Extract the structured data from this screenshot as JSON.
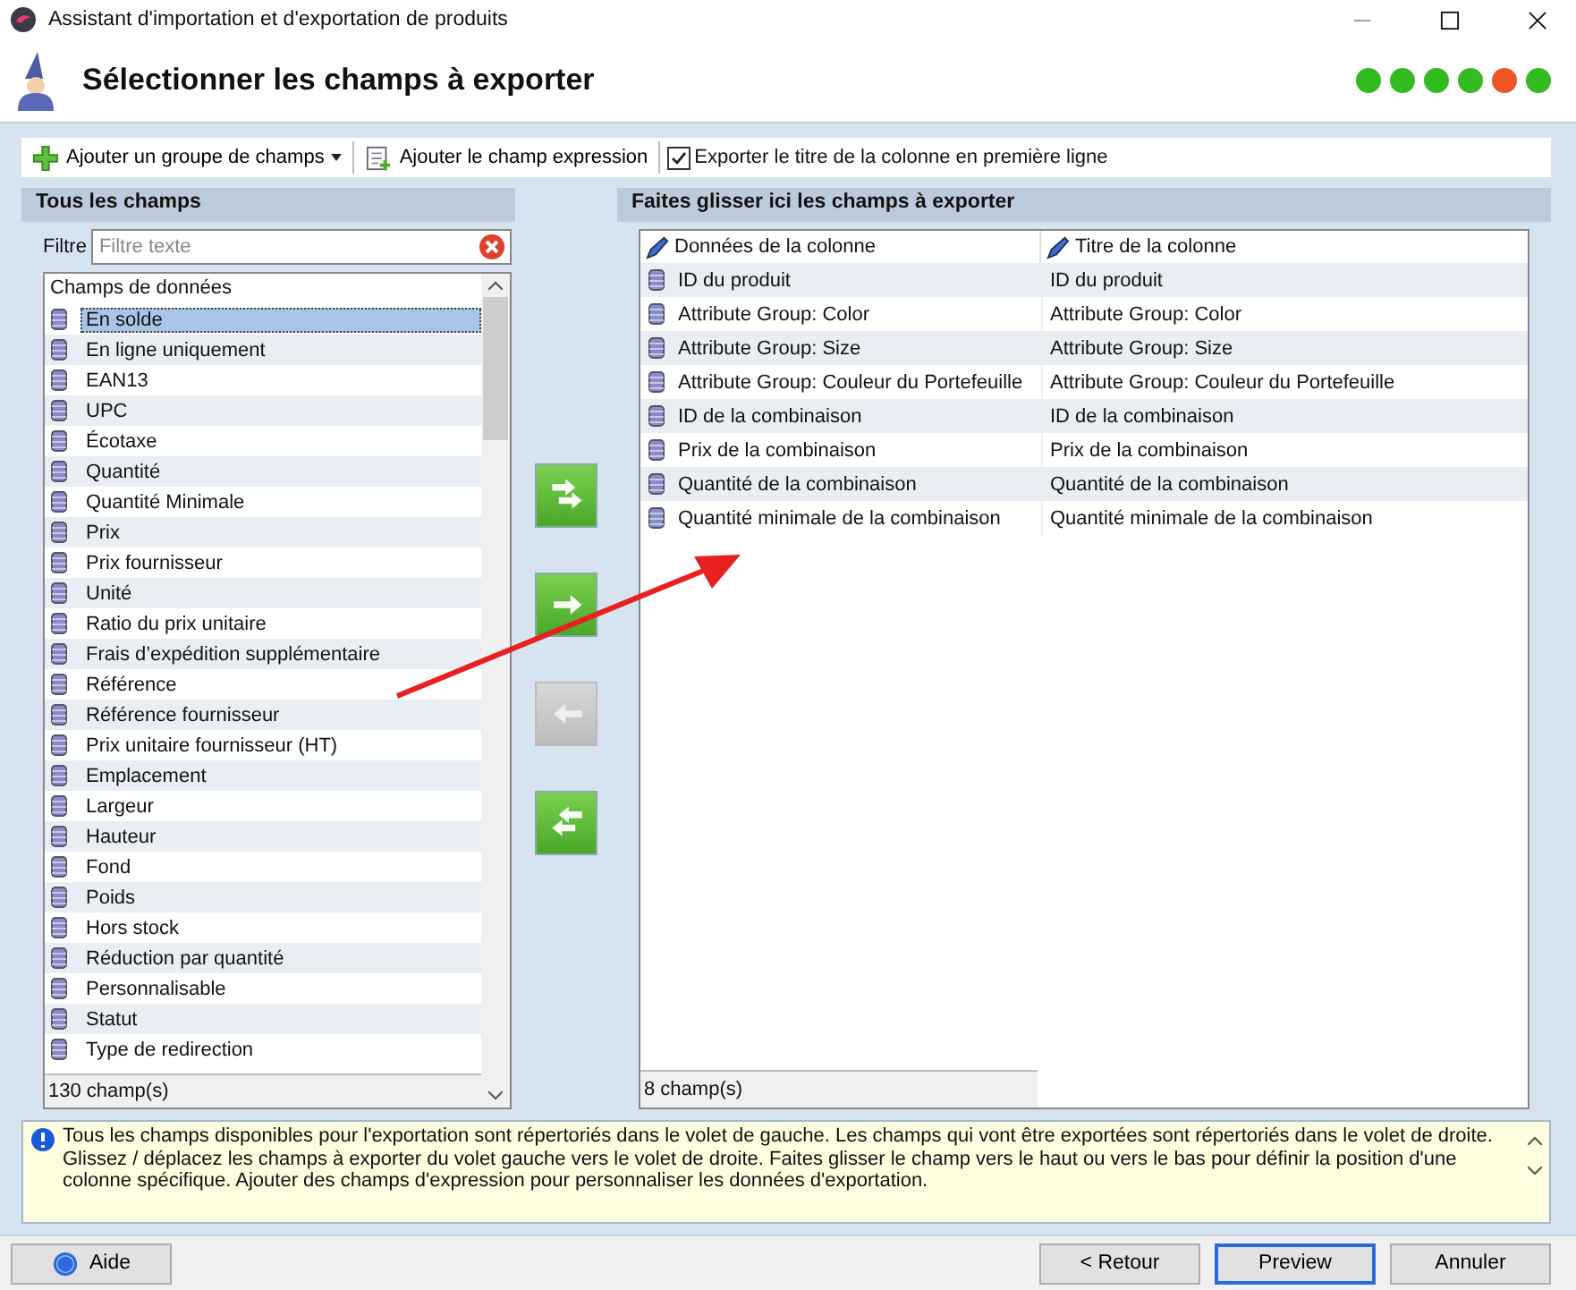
{
  "window": {
    "title": "Assistant d'importation et d'exportation de produits"
  },
  "header": {
    "title": "Sélectionner les champs à exporter",
    "steps": [
      {
        "color": "#33bb22"
      },
      {
        "color": "#33bb22"
      },
      {
        "color": "#33bb22"
      },
      {
        "color": "#33bb22"
      },
      {
        "color": "#ee5522"
      },
      {
        "color": "#33bb22"
      }
    ]
  },
  "toolbar": {
    "add_group": "Ajouter un groupe de champs",
    "add_expression": "Ajouter le champ expression",
    "export_titles": {
      "label": "Exporter le titre de la colonne en première ligne",
      "checked": true
    }
  },
  "left_panel": {
    "title": "Tous les champs",
    "filter_label": "Filtre",
    "filter_placeholder": "Filtre texte",
    "list_header": "Champs de données",
    "items": [
      {
        "label": "En solde",
        "selected": true
      },
      {
        "label": "En ligne uniquement",
        "selected": false
      },
      {
        "label": "EAN13",
        "selected": false
      },
      {
        "label": "UPC",
        "selected": false
      },
      {
        "label": "Écotaxe",
        "selected": false
      },
      {
        "label": "Quantité",
        "selected": false
      },
      {
        "label": "Quantité Minimale",
        "selected": false
      },
      {
        "label": "Prix",
        "selected": false
      },
      {
        "label": "Prix fournisseur",
        "selected": false
      },
      {
        "label": "Unité",
        "selected": false
      },
      {
        "label": "Ratio du prix unitaire",
        "selected": false
      },
      {
        "label": "Frais d’expédition supplémentaire",
        "selected": false
      },
      {
        "label": "Référence",
        "selected": false
      },
      {
        "label": "Référence fournisseur",
        "selected": false
      },
      {
        "label": "Prix unitaire fournisseur (HT)",
        "selected": false
      },
      {
        "label": "Emplacement",
        "selected": false
      },
      {
        "label": "Largeur",
        "selected": false
      },
      {
        "label": "Hauteur",
        "selected": false
      },
      {
        "label": "Fond",
        "selected": false
      },
      {
        "label": "Poids",
        "selected": false
      },
      {
        "label": "Hors stock",
        "selected": false
      },
      {
        "label": "Réduction par quantité",
        "selected": false
      },
      {
        "label": "Personnalisable",
        "selected": false
      },
      {
        "label": "Statut",
        "selected": false
      },
      {
        "label": "Type de redirection",
        "selected": false
      }
    ],
    "count": "130 champ(s)"
  },
  "transfer_buttons": [
    {
      "kind": "add-all",
      "disabled": false
    },
    {
      "kind": "add",
      "disabled": false
    },
    {
      "kind": "remove",
      "disabled": true
    },
    {
      "kind": "remove-all",
      "disabled": false
    }
  ],
  "right_panel": {
    "title": "Faites glisser ici les champs à exporter",
    "columns": [
      "Données de la colonne",
      "Titre de la colonne"
    ],
    "rows": [
      [
        "ID du produit",
        "ID du produit"
      ],
      [
        "Attribute Group: Color",
        "Attribute Group: Color"
      ],
      [
        "Attribute Group: Size",
        "Attribute Group: Size"
      ],
      [
        "Attribute Group: Couleur du Portefeuille",
        "Attribute Group: Couleur du Portefeuille"
      ],
      [
        "ID de la combinaison",
        "ID de la combinaison"
      ],
      [
        "Prix de la combinaison",
        "Prix de la combinaison"
      ],
      [
        "Quantité de la combinaison",
        "Quantité de la combinaison"
      ],
      [
        "Quantité minimale de la combinaison",
        "Quantité minimale de la combinaison"
      ]
    ],
    "count": "8 champ(s)"
  },
  "info": "Tous les champs disponibles pour l'exportation sont répertoriés dans le volet de gauche. Les champs qui vont être exportées sont répertoriés dans le volet de droite. Glissez / déplacez les champs à exporter du volet gauche vers le volet de droite. Faites glisser le champ vers le haut ou vers le bas pour définir la position d'une colonne spécifique. Ajouter des champs d'expression pour personnaliser les données d'exportation.",
  "footer": {
    "help": "Aide",
    "back": "< Retour",
    "preview": "Preview",
    "cancel": "Annuler"
  }
}
